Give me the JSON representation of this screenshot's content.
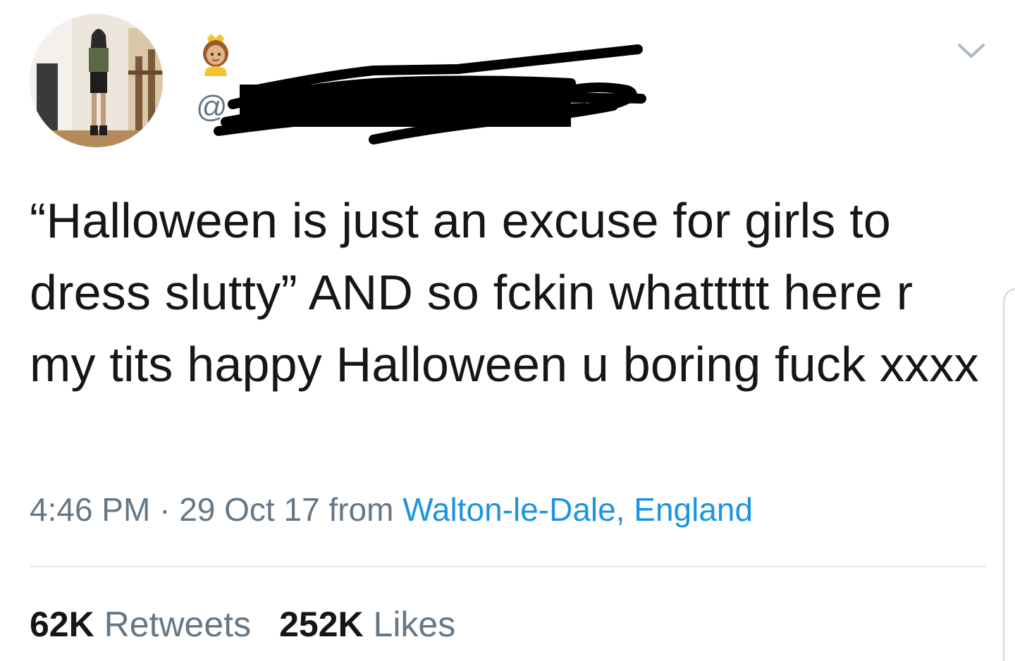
{
  "tweet": {
    "handle_prefix": "@",
    "text": "“Halloween is just an excuse for girls to dress slutty” AND so fckin whattttt here r my tits happy Halloween u boring fuck xxxx",
    "time": "4:46 PM",
    "separator": " · ",
    "date": "29 Oct 17",
    "from_label": " from ",
    "location": "Walton-le-Dale, England",
    "retweets": {
      "count": "62K",
      "label": "Retweets"
    },
    "likes": {
      "count": "252K",
      "label": "Likes"
    }
  },
  "icons": {
    "name_emoji": "princess-emoji-icon",
    "menu": "chevron-down-icon"
  },
  "colors": {
    "text": "#14171a",
    "secondary": "#657786",
    "link": "#1b95e0",
    "divider": "#e1e8ed"
  }
}
